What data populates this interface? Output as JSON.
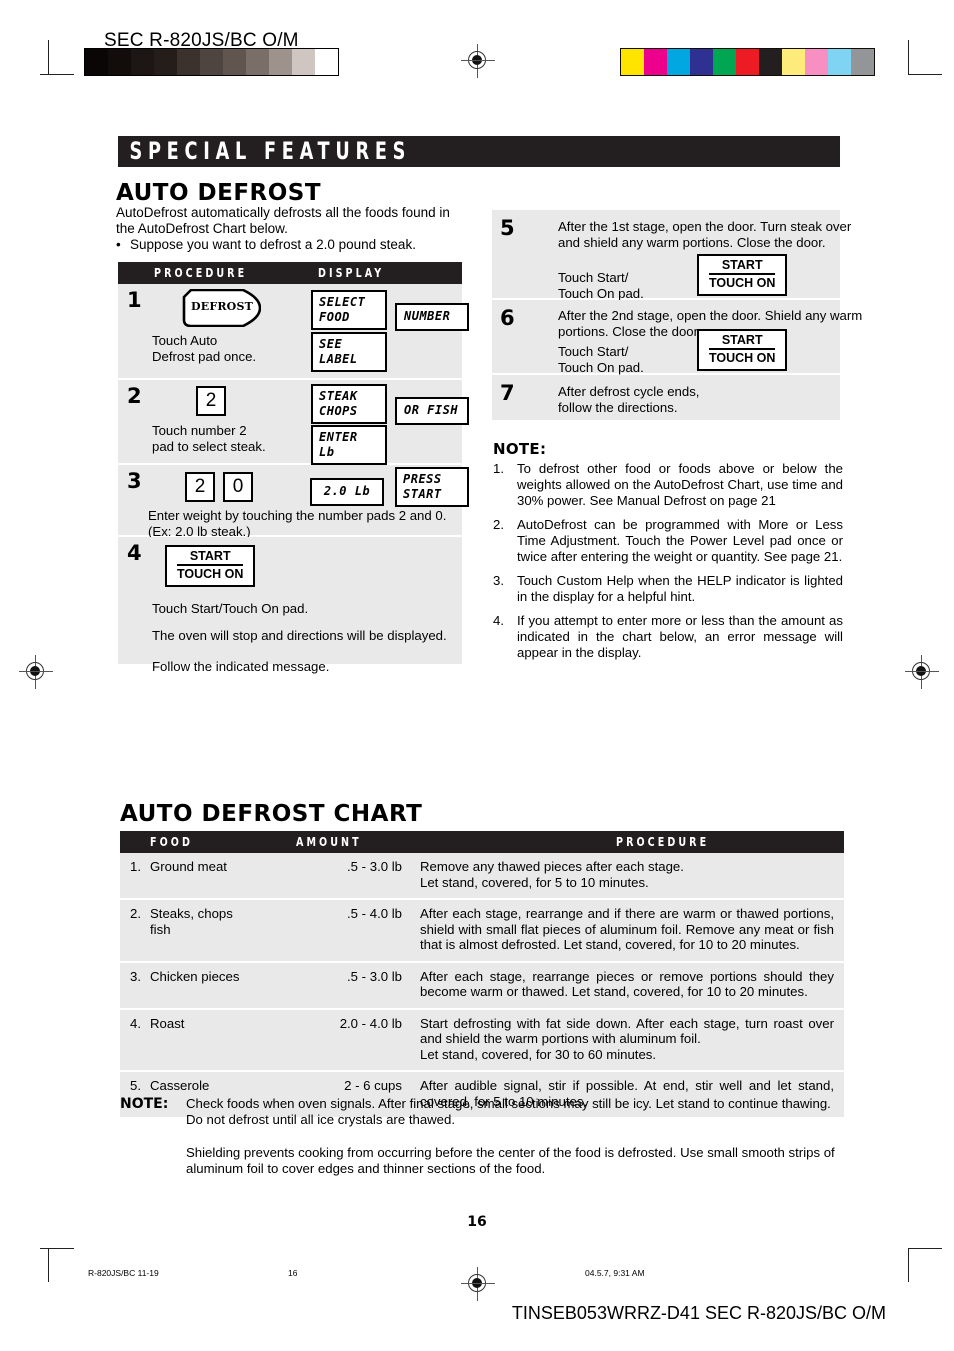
{
  "header": {
    "title": "SEC R-820JS/BC O/M",
    "gray_swatches": [
      "#0a0605",
      "#120d0b",
      "#1c1614",
      "#241d1a",
      "#3b322e",
      "#4e4440",
      "#60554f",
      "#7a6e69",
      "#9d928c",
      "#cfc6c1",
      "#ffffff"
    ],
    "color_swatches": [
      "#ffe400",
      "#ec008c",
      "#00a7e1",
      "#2e3192",
      "#00a651",
      "#ed1c24",
      "#231f20",
      "#fdec7c",
      "#f78fc3",
      "#7fd4f4",
      "#939598"
    ]
  },
  "section": {
    "banner": "SPECIAL FEATURES"
  },
  "auto_defrost": {
    "title": "AUTO DEFROST",
    "intro": "AutoDefrost automatically defrosts all the foods found in the AutoDefrost Chart below.",
    "bullet": "Suppose you want to defrost a 2.0 pound steak."
  },
  "procedure_table": {
    "header": {
      "col_procedure": "PROCEDURE",
      "col_display": "DISPLAY"
    },
    "steps": [
      {
        "number": "1",
        "pad_label": "DEFROST",
        "text": "Touch Auto\nDefrost pad once.",
        "displays": [
          "SELECT\nFOOD",
          "SEE\nLABEL",
          "NUMBER"
        ]
      },
      {
        "number": "2",
        "pad_keys": [
          "2"
        ],
        "text": "Touch number 2\npad to select steak.",
        "displays": [
          "STEAK\nCHOPS",
          "ENTER\nLb",
          "OR FISH"
        ]
      },
      {
        "number": "3",
        "pad_keys": [
          "2",
          "0"
        ],
        "text": "Enter weight by touching the number pads 2 and 0. (Ex: 2.0 lb steak.)",
        "displays": [
          "2.0 Lb",
          "PRESS\nSTART"
        ]
      },
      {
        "number": "4",
        "start_pad": {
          "line1": "START",
          "line2": "TOUCH ON"
        },
        "text1": "Touch Start/Touch On pad.",
        "text2": "The oven will stop and directions will be displayed.",
        "text3": "Follow the indicated message."
      }
    ]
  },
  "right_steps": [
    {
      "number": "5",
      "text1": "After the 1st stage, open the door. Turn steak over and shield any warm portions. Close the  door.",
      "text2": "Touch Start/\nTouch On pad.",
      "start_pad": {
        "line1": "START",
        "line2": "TOUCH ON"
      }
    },
    {
      "number": "6",
      "text1": "After the 2nd stage, open the door. Shield any warm portions. Close the door.",
      "text2": "Touch Start/\nTouch On pad.",
      "start_pad": {
        "line1": "START",
        "line2": "TOUCH ON"
      }
    },
    {
      "number": "7",
      "text1": "After defrost cycle ends,\nfollow the directions."
    }
  ],
  "note_section": {
    "heading": "NOTE:",
    "items": [
      {
        "index": "1.",
        "text": "To defrost other food or foods above or below the weights allowed on the AutoDefrost Chart, use time and 30% power. See Manual Defrost on page 21"
      },
      {
        "index": "2.",
        "text": "AutoDefrost can be programmed with More or Less Time Adjustment. Touch the Power Level pad once or twice after entering the weight or quantity. See page 21."
      },
      {
        "index": "3.",
        "text": "Touch Custom Help when the HELP indicator is lighted in the display for a helpful hint."
      },
      {
        "index": "4.",
        "text": "If you attempt to enter more or less than the amount as indicated in the chart below, an error message will appear in the display."
      }
    ]
  },
  "chart": {
    "title": "AUTO DEFROST CHART",
    "headers": {
      "food": "FOOD",
      "amount": "AMOUNT",
      "procedure": "PROCEDURE"
    },
    "rows": [
      {
        "index": "1.",
        "food": "Ground meat",
        "amount": ".5  -  3.0 lb",
        "procedure": "Remove any thawed pieces after each stage.\nLet stand, covered, for 5 to 10 minutes."
      },
      {
        "index": "2.",
        "food": "Steaks, chops\nfish",
        "amount": ".5  -  4.0 lb",
        "procedure": "After each stage, rearrange and if there are warm or thawed portions, shield with small flat pieces of aluminum foil. Remove any meat or fish that is almost defrosted. Let stand, covered, for 10 to 20 minutes."
      },
      {
        "index": "3.",
        "food": "Chicken pieces",
        "amount": ".5  -  3.0 lb",
        "procedure": "After each stage, rearrange pieces or remove portions should they become warm or thawed. Let stand, covered, for 10 to 20 minutes."
      },
      {
        "index": "4.",
        "food": "Roast",
        "amount": "2.0  -  4.0 lb",
        "procedure": "Start defrosting with fat side down. After each stage, turn roast over and shield the warm portions with aluminum foil.\nLet stand, covered, for 30 to 60 minutes."
      },
      {
        "index": "5.",
        "food": "Casserole",
        "amount": "2  -  6 cups",
        "procedure": "After audible signal, stir if possible. At end, stir well and let stand, covered, for 5 to 10 minutes."
      }
    ]
  },
  "bottom_note": {
    "label": "NOTE:",
    "paragraph1": "Check foods when oven signals. After final stage, small sections may still be icy. Let stand to continue thawing. Do not defrost until all ice crystals are thawed.",
    "paragraph2": "Shielding prevents cooking from occurring before the center of the food is defrosted. Use small smooth strips of aluminum foil to cover edges and thinner sections of the food."
  },
  "page_number": "16",
  "footer": {
    "left": "R-820JS/BC 11-19",
    "mid": "16",
    "date": "04.5.7, 9:31 AM",
    "code": "TINSEB053WRRZ-D41 SEC R-820JS/BC O/M"
  }
}
